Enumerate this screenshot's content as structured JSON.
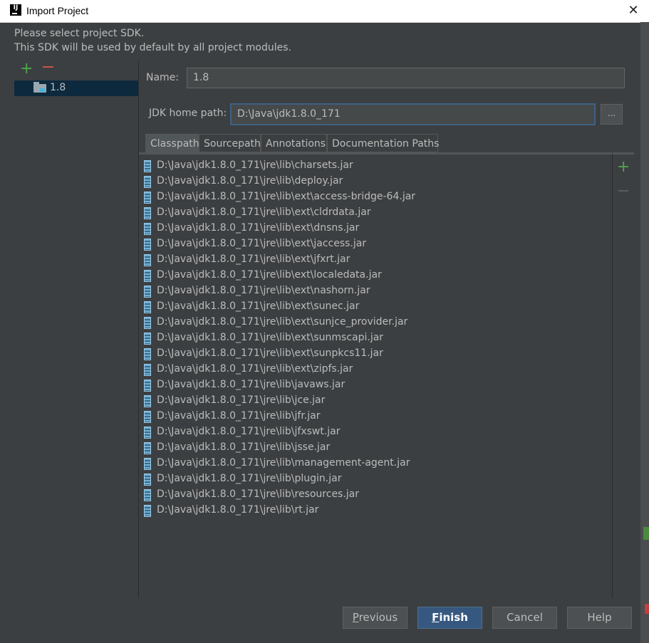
{
  "window": {
    "title": "Import Project",
    "app_icon": "intellij-icon",
    "close_icon": "close-icon"
  },
  "message": {
    "line1": "Please select project SDK.",
    "line2": "This SDK will be used by default by all project modules."
  },
  "sdk_list": {
    "add_icon": "plus-icon",
    "remove_icon": "minus-icon",
    "items": [
      {
        "label": "1.8",
        "icon": "jdk-folder-icon",
        "selected": true
      }
    ]
  },
  "form": {
    "name_label": "Name:",
    "name_value": "1.8",
    "jdk_label": "JDK home path:",
    "jdk_value": "D:\\Java\\jdk1.8.0_171",
    "browse_label": "..."
  },
  "tabs": [
    {
      "label": "Classpath",
      "active": true
    },
    {
      "label": "Sourcepath",
      "active": false
    },
    {
      "label": "Annotations",
      "active": false
    },
    {
      "label": "Documentation Paths",
      "active": false
    }
  ],
  "classpath": [
    "D:\\Java\\jdk1.8.0_171\\jre\\lib\\charsets.jar",
    "D:\\Java\\jdk1.8.0_171\\jre\\lib\\deploy.jar",
    "D:\\Java\\jdk1.8.0_171\\jre\\lib\\ext\\access-bridge-64.jar",
    "D:\\Java\\jdk1.8.0_171\\jre\\lib\\ext\\cldrdata.jar",
    "D:\\Java\\jdk1.8.0_171\\jre\\lib\\ext\\dnsns.jar",
    "D:\\Java\\jdk1.8.0_171\\jre\\lib\\ext\\jaccess.jar",
    "D:\\Java\\jdk1.8.0_171\\jre\\lib\\ext\\jfxrt.jar",
    "D:\\Java\\jdk1.8.0_171\\jre\\lib\\ext\\localedata.jar",
    "D:\\Java\\jdk1.8.0_171\\jre\\lib\\ext\\nashorn.jar",
    "D:\\Java\\jdk1.8.0_171\\jre\\lib\\ext\\sunec.jar",
    "D:\\Java\\jdk1.8.0_171\\jre\\lib\\ext\\sunjce_provider.jar",
    "D:\\Java\\jdk1.8.0_171\\jre\\lib\\ext\\sunmscapi.jar",
    "D:\\Java\\jdk1.8.0_171\\jre\\lib\\ext\\sunpkcs11.jar",
    "D:\\Java\\jdk1.8.0_171\\jre\\lib\\ext\\zipfs.jar",
    "D:\\Java\\jdk1.8.0_171\\jre\\lib\\javaws.jar",
    "D:\\Java\\jdk1.8.0_171\\jre\\lib\\jce.jar",
    "D:\\Java\\jdk1.8.0_171\\jre\\lib\\jfr.jar",
    "D:\\Java\\jdk1.8.0_171\\jre\\lib\\jfxswt.jar",
    "D:\\Java\\jdk1.8.0_171\\jre\\lib\\jsse.jar",
    "D:\\Java\\jdk1.8.0_171\\jre\\lib\\management-agent.jar",
    "D:\\Java\\jdk1.8.0_171\\jre\\lib\\plugin.jar",
    "D:\\Java\\jdk1.8.0_171\\jre\\lib\\resources.jar",
    "D:\\Java\\jdk1.8.0_171\\jre\\lib\\rt.jar"
  ],
  "classpath_tools": {
    "add_icon": "plus-icon",
    "remove_icon": "minus-icon"
  },
  "buttons": {
    "previous": "Previous",
    "finish": "Finish",
    "cancel": "Cancel",
    "help": "Help"
  },
  "colors": {
    "background": "#3c3f41",
    "selection": "#0d293e",
    "primary_button": "#365880",
    "add_green": "#4ca64c",
    "remove_red": "#c75450",
    "focus_border": "#3d6185"
  }
}
